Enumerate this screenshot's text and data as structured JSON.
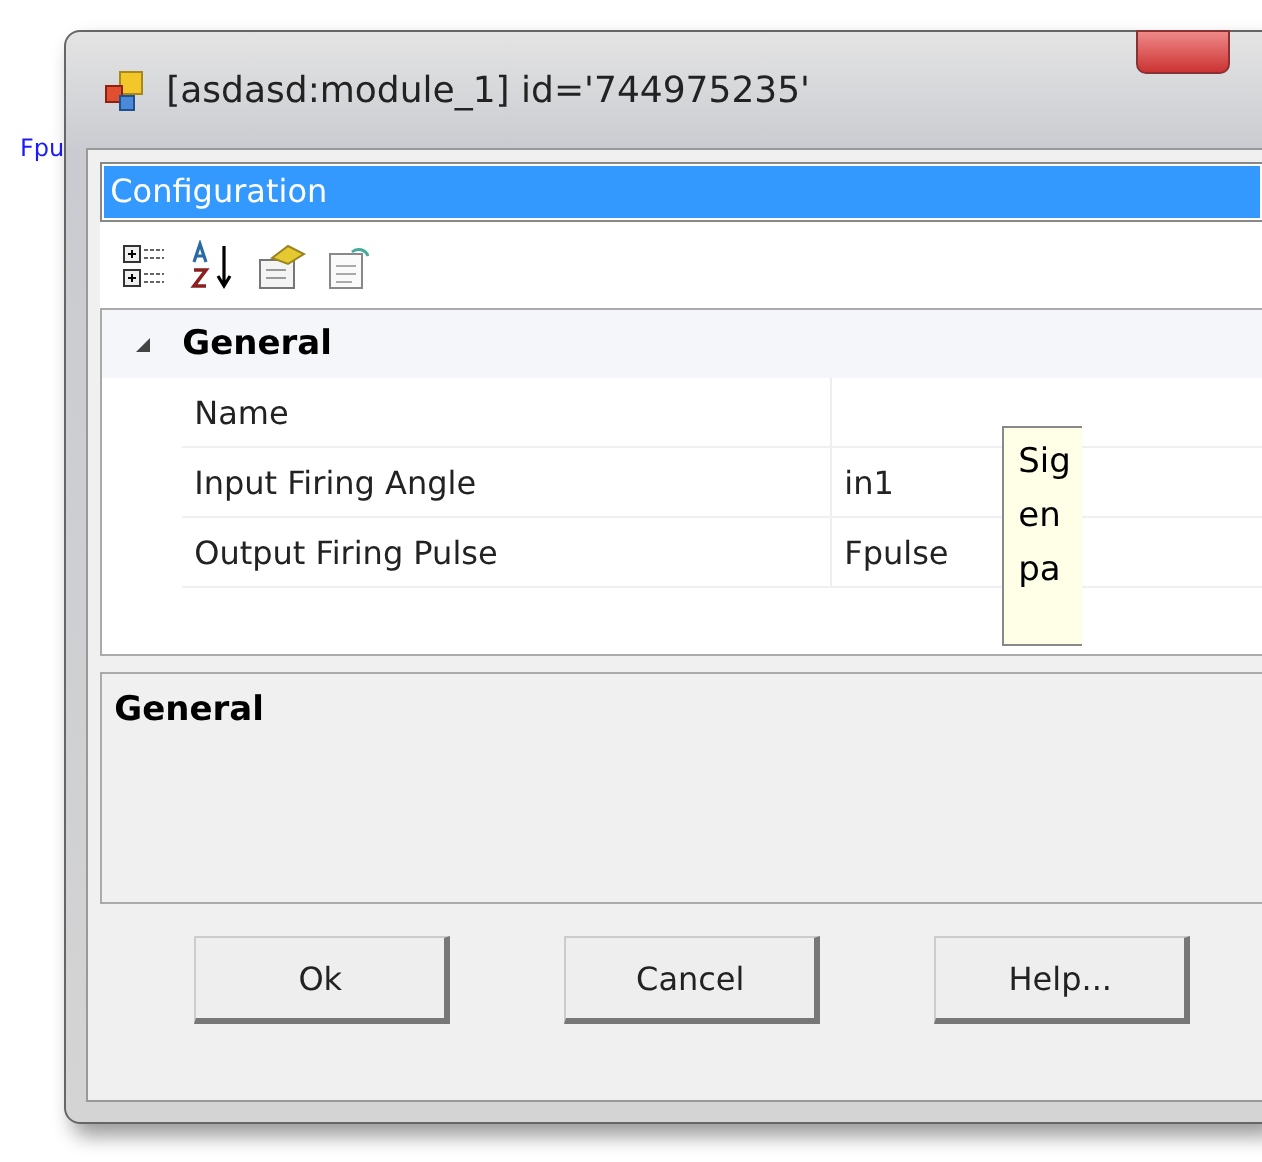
{
  "background_label": "Fpu",
  "window": {
    "title": "[asdasd:module_1] id='744975235'"
  },
  "object_selector": {
    "value": "Configuration",
    "selected": true
  },
  "property_grid": {
    "category": "General",
    "expanded": true,
    "rows": [
      {
        "name": "Name",
        "value": ""
      },
      {
        "name": "Input Firing Angle",
        "value": "in1"
      },
      {
        "name": "Output Firing Pulse",
        "value": "Fpulse"
      }
    ]
  },
  "tooltip": {
    "lines": [
      "Sig",
      "en",
      "pa"
    ]
  },
  "description": {
    "title": "General"
  },
  "buttons": [
    "Ok",
    "Cancel",
    "Help..."
  ]
}
